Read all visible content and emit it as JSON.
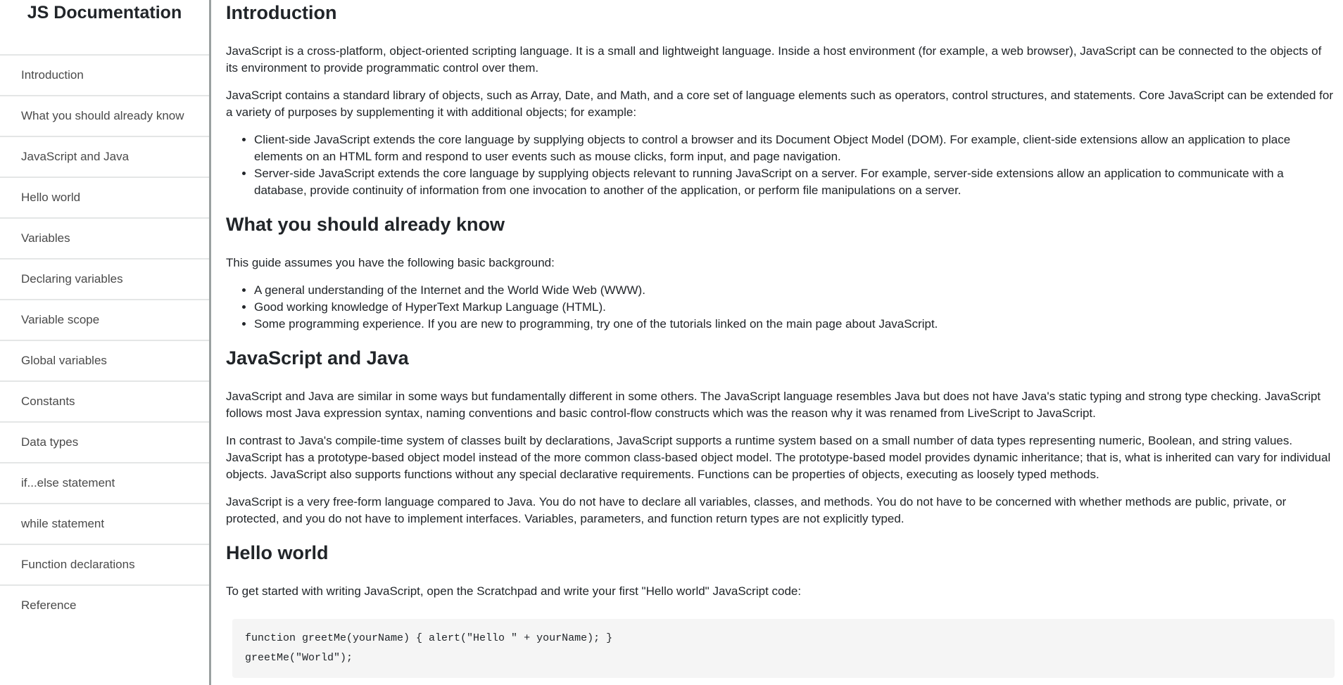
{
  "sidebar": {
    "title": "JS Documentation",
    "items": [
      "Introduction",
      "What you should already know",
      "JavaScript and Java",
      "Hello world",
      "Variables",
      "Declaring variables",
      "Variable scope",
      "Global variables",
      "Constants",
      "Data types",
      "if...else statement",
      "while statement",
      "Function declarations",
      "Reference"
    ]
  },
  "sections": {
    "intro": {
      "title": "Introduction",
      "p1": "JavaScript is a cross-platform, object-oriented scripting language. It is a small and lightweight language. Inside a host environment (for example, a web browser), JavaScript can be connected to the objects of its environment to provide programmatic control over them.",
      "p2": "JavaScript contains a standard library of objects, such as Array, Date, and Math, and a core set of language elements such as operators, control structures, and statements. Core JavaScript can be extended for a variety of purposes by supplementing it with additional objects; for example:",
      "bullets": [
        "Client-side JavaScript extends the core language by supplying objects to control a browser and its Document Object Model (DOM). For example, client-side extensions allow an application to place elements on an HTML form and respond to user events such as mouse clicks, form input, and page navigation.",
        "Server-side JavaScript extends the core language by supplying objects relevant to running JavaScript on a server. For example, server-side extensions allow an application to communicate with a database, provide continuity of information from one invocation to another of the application, or perform file manipulations on a server."
      ]
    },
    "know": {
      "title": "What you should already know",
      "p1": "This guide assumes you have the following basic background:",
      "bullets": [
        "A general understanding of the Internet and the World Wide Web (WWW).",
        "Good working knowledge of HyperText Markup Language (HTML).",
        "Some programming experience. If you are new to programming, try one of the tutorials linked on the main page about JavaScript."
      ]
    },
    "java": {
      "title": "JavaScript and Java",
      "p1": "JavaScript and Java are similar in some ways but fundamentally different in some others. The JavaScript language resembles Java but does not have Java's static typing and strong type checking. JavaScript follows most Java expression syntax, naming conventions and basic control-flow constructs which was the reason why it was renamed from LiveScript to JavaScript.",
      "p2": "In contrast to Java's compile-time system of classes built by declarations, JavaScript supports a runtime system based on a small number of data types representing numeric, Boolean, and string values. JavaScript has a prototype-based object model instead of the more common class-based object model. The prototype-based model provides dynamic inheritance; that is, what is inherited can vary for individual objects. JavaScript also supports functions without any special declarative requirements. Functions can be properties of objects, executing as loosely typed methods.",
      "p3": "JavaScript is a very free-form language compared to Java. You do not have to declare all variables, classes, and methods. You do not have to be concerned with whether methods are public, private, or protected, and you do not have to implement interfaces. Variables, parameters, and function return types are not explicitly typed."
    },
    "hello": {
      "title": "Hello world",
      "p1": "To get started with writing JavaScript, open the Scratchpad and write your first \"Hello world\" JavaScript code:",
      "code": [
        "function greetMe(yourName) { alert(\"Hello \" + yourName); }",
        "greetMe(\"World\");"
      ]
    }
  }
}
